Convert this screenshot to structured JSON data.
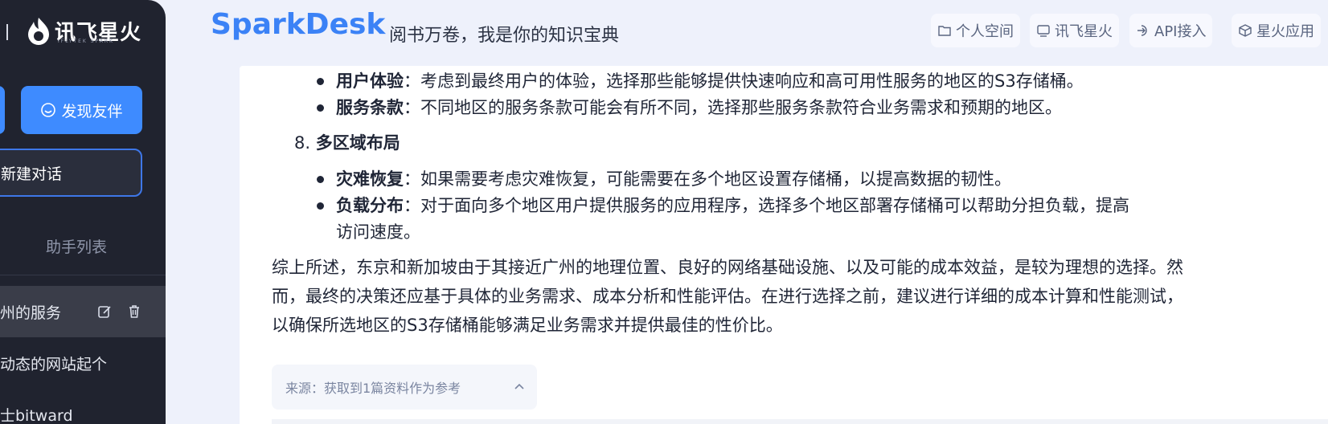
{
  "sidebar": {
    "logo_text": "讯飞星火",
    "logo_sub": "IFLYTEK SPARK",
    "discover_button": "发现友伴",
    "new_chat_button": "新建对话",
    "assistant_list_title": "助手列表",
    "history": [
      {
        "label": "州的服务"
      },
      {
        "label": "动态的网站起个"
      },
      {
        "label": "士bitward"
      }
    ]
  },
  "header": {
    "brand": "SparkDesk",
    "slogan": "阅书万卷，我是你的知识宝典",
    "nav": [
      {
        "label": "个人空间",
        "icon": "folder-icon"
      },
      {
        "label": "讯飞星火",
        "icon": "monitor-icon"
      },
      {
        "label": "API接入",
        "icon": "api-login-icon"
      },
      {
        "label": "星火应用",
        "icon": "cube-icon"
      }
    ]
  },
  "content": {
    "item1_title": "用户体验",
    "item1_text": "：考虑到最终用户的体验，选择那些能够提供快速响应和高可用性服务的地区的S3存储桶。",
    "item2_title": "服务条款",
    "item2_text": "：不同地区的服务条款可能会有所不同，选择那些服务条款符合业务需求和预期的地区。",
    "section8_num": "8.",
    "section8_title": "多区域布局",
    "item3_title": "灾难恢复",
    "item3_text": "：如果需要考虑灾难恢复，可能需要在多个地区设置存储桶，以提高数据的韧性。",
    "item4_title": "负载分布",
    "item4_text": "：对于面向多个地区用户提供服务的应用程序，选择多个地区部署存储桶可以帮助分担负载，提高",
    "item4_text2": "访问速度。",
    "summary_line1": "综上所述，东京和新加坡由于其接近广州的地理位置、良好的网络基础设施、以及可能的成本效益，是较为理想的选择。然",
    "summary_line2": "而，最终的决策还应基于具体的业务需求、成本分析和性能评估。在进行选择之前，建议进行详细的成本计算和性能测试，",
    "summary_line3": "以确保所选地区的S3存储桶能够满足业务需求并提供最佳的性价比。",
    "source_label": "来源：获取到1篇资料作为参考"
  },
  "colors": {
    "accent": "#3e8bff",
    "sidebar_bg": "#20232f",
    "page_bg": "#eef1fb",
    "brand": "#3b82f6"
  }
}
